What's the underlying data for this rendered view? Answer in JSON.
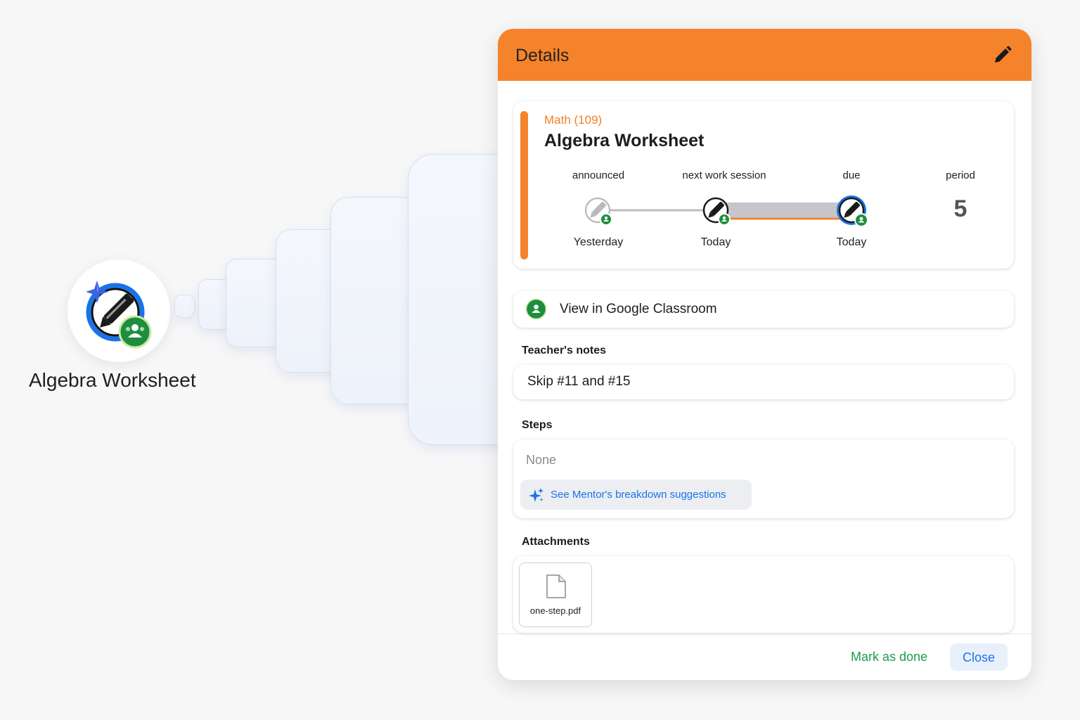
{
  "app": {
    "title": "Algebra Worksheet",
    "icon": "pencil-with-classroom-badge-icon"
  },
  "panel": {
    "title": "Details",
    "edit_icon": "pencil-icon",
    "header_color": "#f5832b"
  },
  "assignment": {
    "course": "Math (109)",
    "name": "Algebra Worksheet",
    "timeline": {
      "announced": {
        "label": "announced",
        "date": "Yesterday"
      },
      "next_session": {
        "label": "next work session",
        "date": "Today"
      },
      "due": {
        "label": "due",
        "date": "Today"
      }
    },
    "period": {
      "label": "period",
      "value": "5"
    }
  },
  "classroom_link": {
    "label": "View in Google Classroom",
    "icon": "google-classroom-icon"
  },
  "teacher_notes": {
    "heading": "Teacher's notes",
    "text": "Skip #11 and #15"
  },
  "steps": {
    "heading": "Steps",
    "value": "None",
    "suggest_label": "See Mentor's breakdown suggestions",
    "suggest_icon": "sparkle-icon"
  },
  "attachments": {
    "heading": "Attachments",
    "files": [
      {
        "name": "one-step.pdf",
        "icon": "document-icon"
      }
    ]
  },
  "footer": {
    "mark_done": "Mark as done",
    "close": "Close"
  },
  "colors": {
    "accent": "#f5832b",
    "link": "#1a73e8",
    "success": "#1e9b4b",
    "classroom_green": "#1e8e3e"
  }
}
